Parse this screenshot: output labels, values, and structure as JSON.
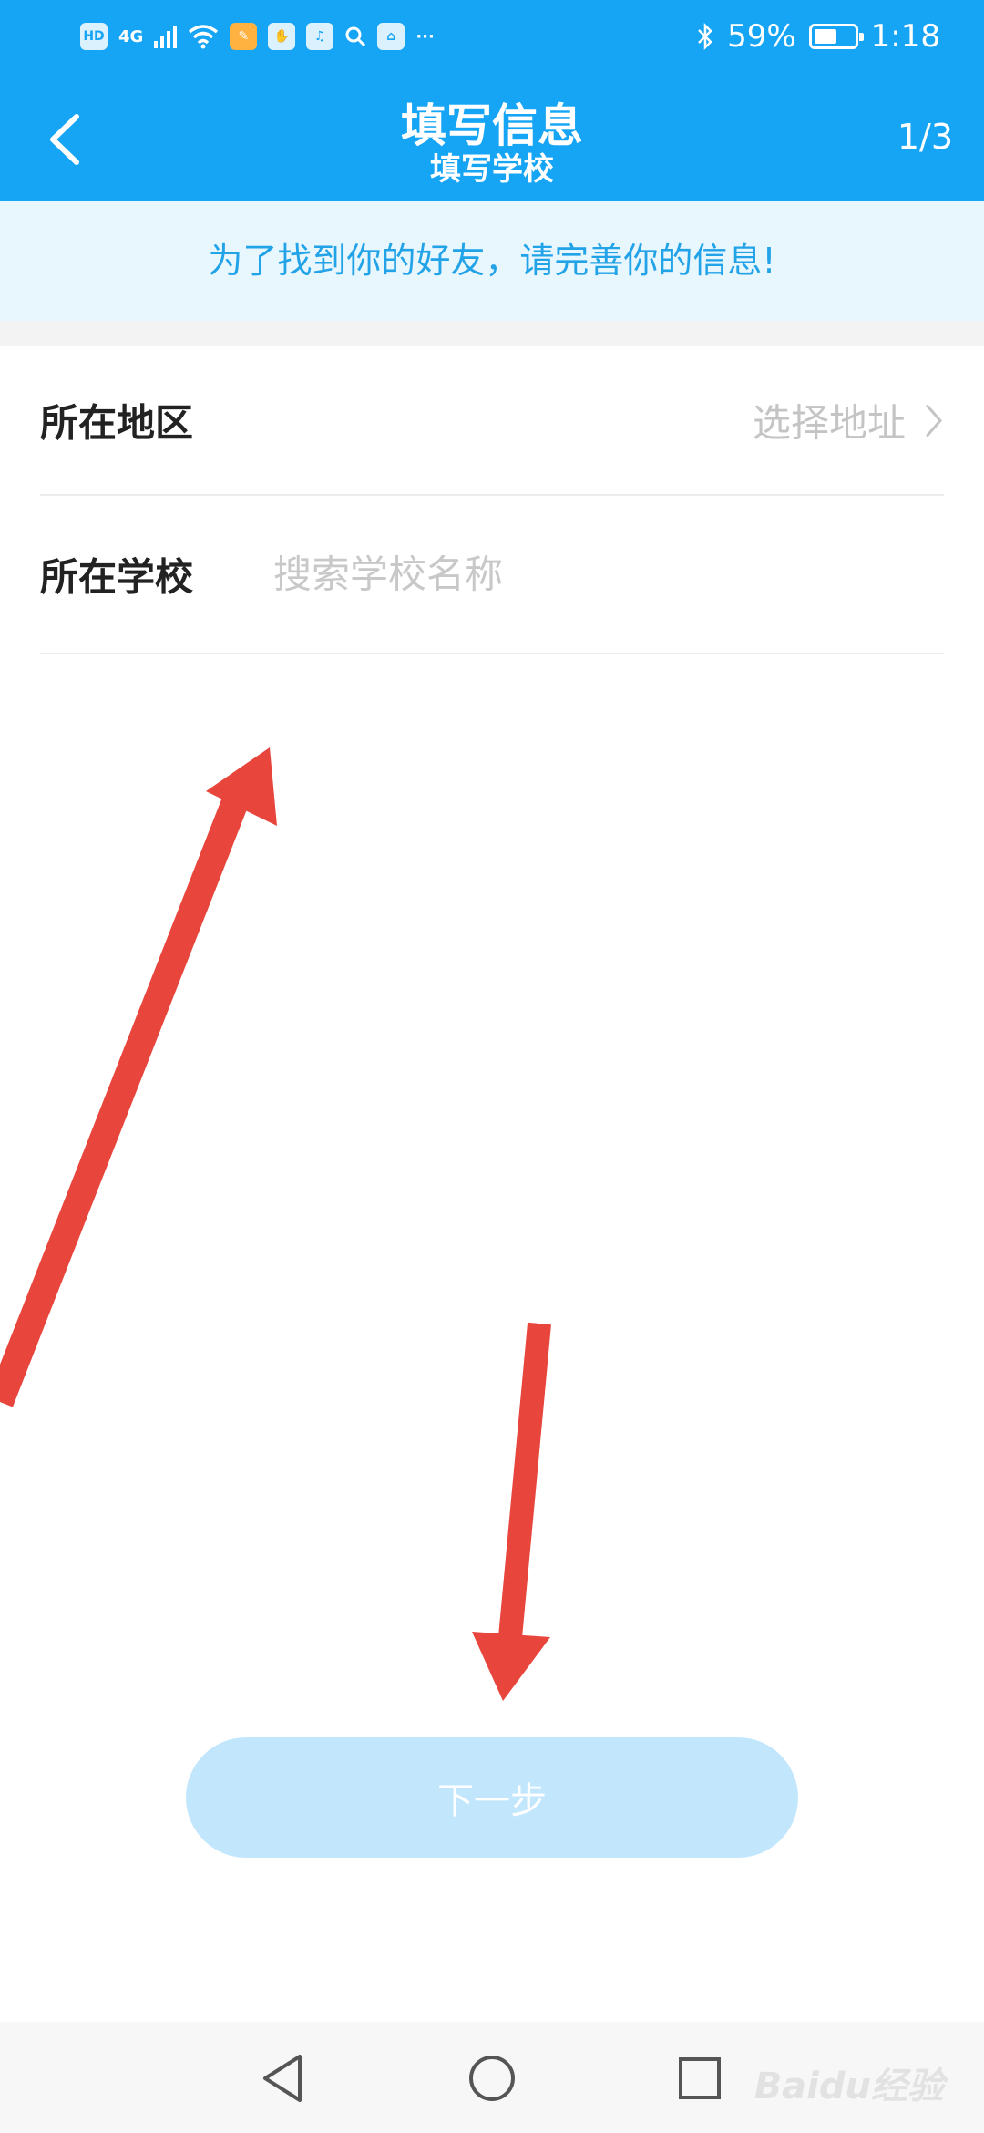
{
  "status_bar": {
    "hd_label": "HD",
    "network_label": "4G",
    "battery_percent": "59%",
    "battery_level": 0.59,
    "time": "1:18",
    "more_label": "···",
    "icons": [
      "hd-icon",
      "signal-icon",
      "wifi-icon",
      "app-icon",
      "hand-icon",
      "music-icon",
      "search-icon",
      "store-icon",
      "bluetooth-icon",
      "battery-icon"
    ]
  },
  "header": {
    "title": "填写信息",
    "subtitle": "填写学校",
    "step": "1/3"
  },
  "banner": {
    "text": "为了找到你的好友，请完善你的信息!"
  },
  "form": {
    "region": {
      "label": "所在地区",
      "value": "选择地址"
    },
    "school": {
      "label": "所在学校",
      "placeholder": "搜索学校名称",
      "value": ""
    }
  },
  "next_button": {
    "label": "下一步"
  },
  "colors": {
    "primary": "#16a4f5",
    "banner_bg": "#e8f6fe",
    "banner_text": "#22a3e8",
    "button_disabled": "#c2e7fc",
    "annotation_arrow": "#e8453c"
  },
  "watermark": {
    "text": "Baidu经验"
  }
}
